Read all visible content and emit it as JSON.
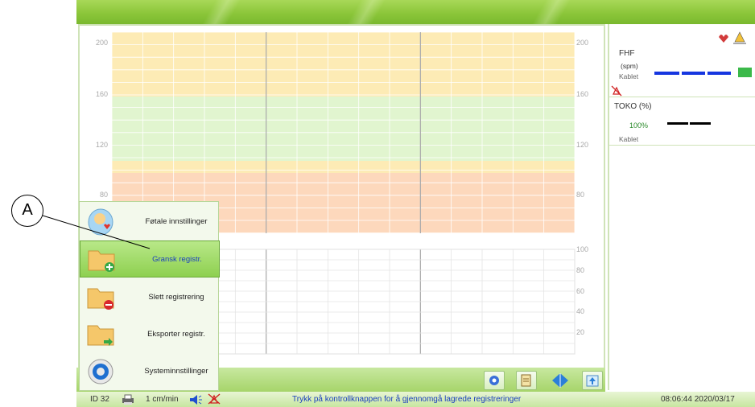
{
  "chart": {
    "fhr_ticks": [
      "200",
      "160",
      "120",
      "80"
    ],
    "fhr_ticks_right": [
      "200",
      "160",
      "120",
      "80"
    ],
    "toco_ticks_right": [
      "100",
      "80",
      "60",
      "40",
      "20"
    ]
  },
  "menu": {
    "items": [
      {
        "label": "Føtale innstillinger"
      },
      {
        "label": "Gransk registr."
      },
      {
        "label": "Slett registrering"
      },
      {
        "label": "Eksporter registr."
      },
      {
        "label": "Systeminnstillinger"
      }
    ]
  },
  "right_panel": {
    "fhf_label": "FHF",
    "fhf_unit": "(spm)",
    "fhf_source": "Kablet",
    "toko_label": "TOKO (%)",
    "toko_value": "100%",
    "toko_source": "Kablet"
  },
  "status": {
    "id": "ID 32",
    "speed": "1 cm/min",
    "message": "Trykk på kontrollknappen for å gjennomgå lagrede registreringer",
    "datetime": "08:06:44 2020/03/17"
  },
  "callout": {
    "letter": "A"
  },
  "colors": {
    "accent": "#8cc63a",
    "fhr_warn": "#fdebb5",
    "fhr_normal": "#e1f5cf",
    "fhr_alarm": "#fdd8bc",
    "selected_text": "#1a3fbf"
  }
}
